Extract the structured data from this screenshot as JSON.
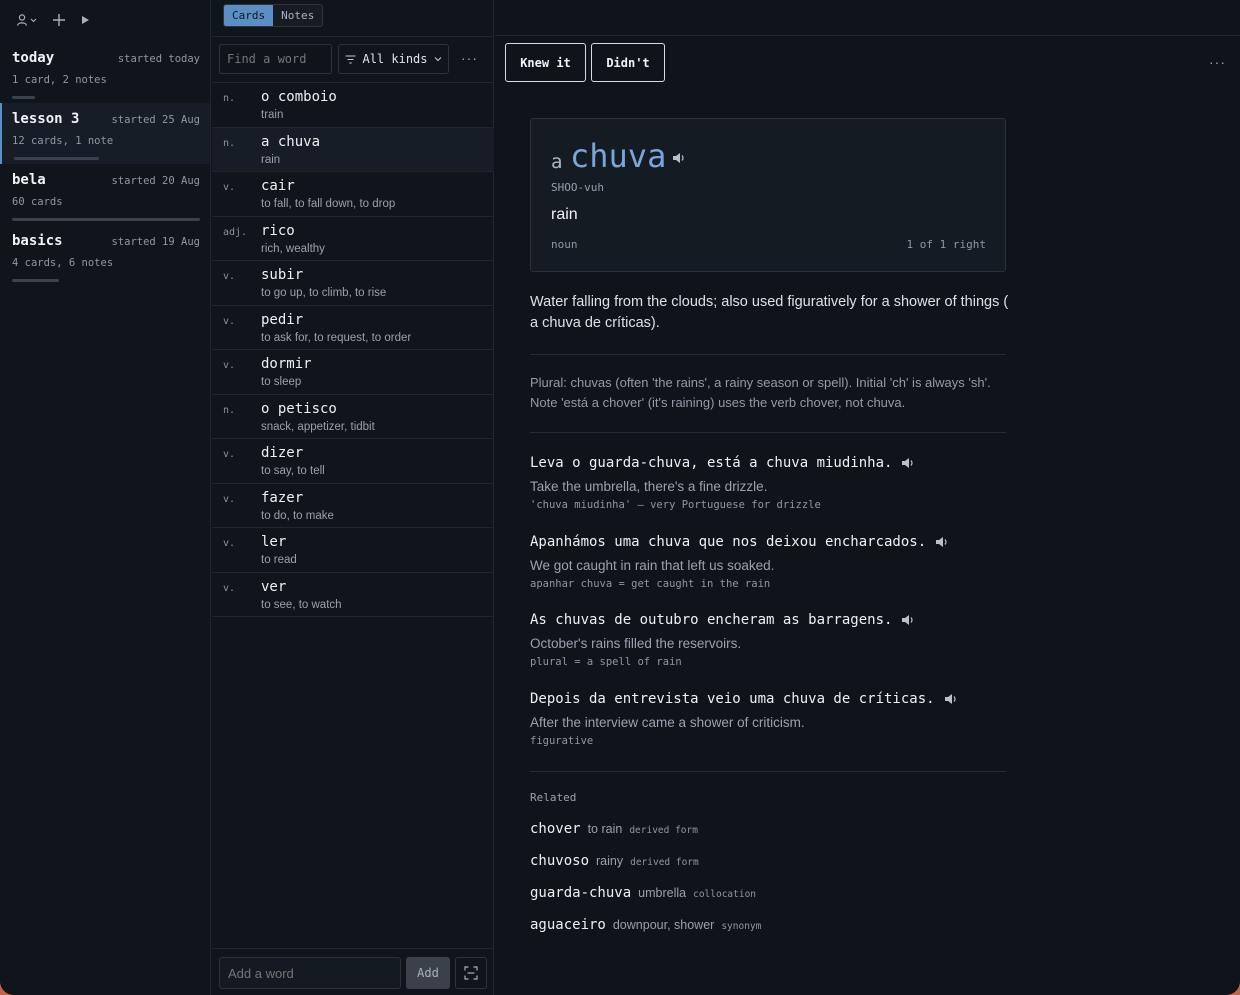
{
  "sidebar": {
    "decks": [
      {
        "name": "today",
        "started": "started today",
        "count": "1 card, 2 notes",
        "progress": 0.12
      },
      {
        "name": "lesson 3",
        "started": "started 25 Aug",
        "count": "12 cards, 1 note",
        "progress": 0.45
      },
      {
        "name": "bela",
        "started": "started 20 Aug",
        "count": "60 cards",
        "progress": 1.0
      },
      {
        "name": "basics",
        "started": "started 19 Aug",
        "count": "4 cards, 6 notes",
        "progress": 0.25
      }
    ]
  },
  "middle": {
    "tabs": [
      "Cards",
      "Notes"
    ],
    "search_placeholder": "Find a word",
    "filter_label": "All kinds",
    "more": "···",
    "items": [
      {
        "pos": "n.",
        "word": "o comboio",
        "gloss": "train"
      },
      {
        "pos": "n.",
        "word": "a chuva",
        "gloss": "rain"
      },
      {
        "pos": "v.",
        "word": "cair",
        "gloss": "to fall, to fall down, to drop"
      },
      {
        "pos": "adj.",
        "word": "rico",
        "gloss": "rich, wealthy"
      },
      {
        "pos": "v.",
        "word": "subir",
        "gloss": "to go up, to climb, to rise"
      },
      {
        "pos": "v.",
        "word": "pedir",
        "gloss": "to ask for, to request, to order"
      },
      {
        "pos": "v.",
        "word": "dormir",
        "gloss": "to sleep"
      },
      {
        "pos": "n.",
        "word": "o petisco",
        "gloss": "snack, appetizer, tidbit"
      },
      {
        "pos": "v.",
        "word": "dizer",
        "gloss": "to say, to tell"
      },
      {
        "pos": "v.",
        "word": "fazer",
        "gloss": "to do, to make"
      },
      {
        "pos": "v.",
        "word": "ler",
        "gloss": "to read"
      },
      {
        "pos": "v.",
        "word": "ver",
        "gloss": "to see, to watch"
      }
    ],
    "add_placeholder": "Add a word",
    "add_label": "Add"
  },
  "right": {
    "knew_label": "Knew it",
    "didnt_label": "Didn't",
    "more": "···",
    "card": {
      "article": "a",
      "headword": "chuva",
      "pronunciation": "SHOO-vuh",
      "translation": "rain",
      "pos": "noun",
      "score": "1 of 1 right"
    },
    "definition": "Water falling from the clouds; also used figuratively for a shower of things ( a chuva de críticas).",
    "note": "Plural: chuvas (often 'the rains', a rainy season or spell). Initial 'ch' is always 'sh'. Note 'está a chover' (it's raining) uses the verb chover, not chuva.",
    "examples": [
      {
        "pt": "Leva o guarda-chuva, está a chuva miudinha.",
        "en": "Take the umbrella, there's a fine drizzle.",
        "note": "'chuva miudinha' — very Portuguese for drizzle"
      },
      {
        "pt": "Apanhámos uma chuva que nos deixou encharcados.",
        "en": "We got caught in rain that left us soaked.",
        "note": "apanhar chuva = get caught in the rain"
      },
      {
        "pt": "As chuvas de outubro encheram as barragens.",
        "en": "October's rains filled the reservoirs.",
        "note": "plural = a spell of rain"
      },
      {
        "pt": "Depois da entrevista veio uma chuva de críticas.",
        "en": "After the interview came a shower of criticism.",
        "note": "figurative"
      }
    ],
    "related_title": "Related",
    "related": [
      {
        "word": "chover",
        "gloss": "to rain",
        "tag": "derived form"
      },
      {
        "word": "chuvoso",
        "gloss": "rainy",
        "tag": "derived form"
      },
      {
        "word": "guarda-chuva",
        "gloss": "umbrella",
        "tag": "collocation"
      },
      {
        "word": "aguaceiro",
        "gloss": "downpour, shower",
        "tag": "synonym"
      }
    ]
  }
}
